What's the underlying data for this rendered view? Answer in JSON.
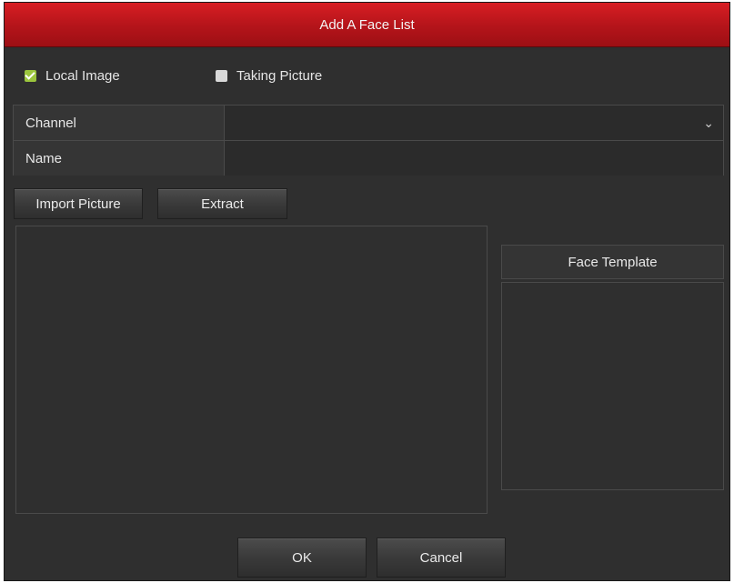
{
  "dialog": {
    "title": "Add A Face List"
  },
  "mode": {
    "local_image": {
      "label": "Local Image",
      "checked": true
    },
    "taking_picture": {
      "label": "Taking Picture",
      "checked": false
    }
  },
  "form": {
    "channel": {
      "label": "Channel",
      "value": ""
    },
    "name": {
      "label": "Name",
      "value": ""
    }
  },
  "actions": {
    "import_label": "Import Picture",
    "extract_label": "Extract"
  },
  "template": {
    "header": "Face Template"
  },
  "footer": {
    "ok_label": "OK",
    "cancel_label": "Cancel"
  },
  "colors": {
    "title_bar": "#c8161c",
    "background": "#2f2f2f",
    "checkbox_checked": "#9bc53d"
  }
}
